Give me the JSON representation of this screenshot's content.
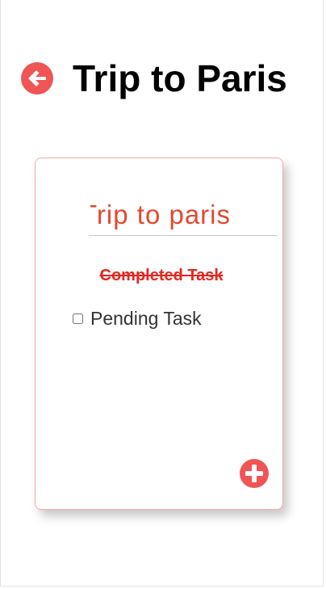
{
  "header": {
    "title": "Trip to Paris",
    "back_icon": "arrow-left-circle-icon"
  },
  "card": {
    "title_value": "Trip to paris",
    "tasks": [
      {
        "label": "Completed Task",
        "completed": true
      },
      {
        "label": "Pending Task",
        "completed": false
      }
    ],
    "add_icon": "plus-circle-icon"
  },
  "colors": {
    "accent": "#f05454",
    "title_input_text": "#e2492e",
    "completed_text": "#e8261f",
    "card_border": "#f7a9a4"
  }
}
